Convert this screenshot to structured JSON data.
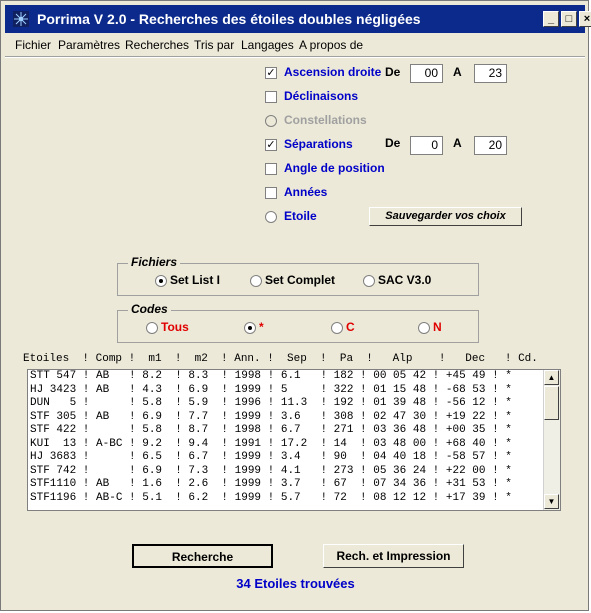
{
  "window": {
    "title": "Porrima V 2.0 - Recherches des étoiles doubles négligées",
    "buttons": {
      "minimize": "_",
      "maximize": "□",
      "close": "×"
    }
  },
  "menu": [
    "Fichier",
    "Paramètres",
    "Recherches",
    "Tris par",
    "Langages",
    "A propos de"
  ],
  "criteria": {
    "ascension": {
      "label": "Ascension droite",
      "checked": true,
      "de_label": "De",
      "from": "00",
      "a_label": "A",
      "to": "23"
    },
    "declinaisons": {
      "label": "Déclinaisons",
      "checked": false
    },
    "constellations": {
      "label": "Constellations",
      "disabled": true
    },
    "separations": {
      "label": "Séparations",
      "checked": true,
      "de_label": "De",
      "from": "0",
      "a_label": "A",
      "to": "20"
    },
    "angle": {
      "label": "Angle de position",
      "checked": false
    },
    "annees": {
      "label": "Années",
      "checked": false
    },
    "etoile": {
      "label": "Etoile",
      "selected": false
    },
    "save_button": "Sauvegarder vos choix"
  },
  "fichiers": {
    "title": "Fichiers",
    "options": [
      {
        "label": "Set List I",
        "selected": true
      },
      {
        "label": "Set Complet",
        "selected": false
      },
      {
        "label": "SAC V3.0",
        "selected": false
      }
    ]
  },
  "codes": {
    "title": "Codes",
    "options": [
      {
        "label": "Tous",
        "selected": false
      },
      {
        "label": "*",
        "selected": true
      },
      {
        "label": "C",
        "selected": false
      },
      {
        "label": "N",
        "selected": false
      }
    ],
    "color": "#e00000"
  },
  "list": {
    "header": "Etoiles  ! Comp !  m1  !  m2  ! Ann. !  Sep  !  Pa  !   Alp    !   Dec   ! Cd.",
    "rows": [
      "STT 547 ! AB   ! 8.2  ! 8.3  ! 1998 ! 6.1   ! 182 ! 00 05 42 ! +45 49 ! *",
      "HJ 3423 ! AB   ! 4.3  ! 6.9  ! 1999 ! 5     ! 322 ! 01 15 48 ! -68 53 ! *",
      "DUN   5 !      ! 5.8  ! 5.9  ! 1996 ! 11.3  ! 192 ! 01 39 48 ! -56 12 ! *",
      "STF 305 ! AB   ! 6.9  ! 7.7  ! 1999 ! 3.6   ! 308 ! 02 47 30 ! +19 22 ! *",
      "STF 422 !      ! 5.8  ! 8.7  ! 1998 ! 6.7   ! 271 ! 03 36 48 ! +00 35 ! *",
      "KUI  13 ! A-BC ! 9.2  ! 9.4  ! 1991 ! 17.2  ! 14  ! 03 48 00 ! +68 40 ! *",
      "HJ 3683 !      ! 6.5  ! 6.7  ! 1999 ! 3.4   ! 90  ! 04 40 18 ! -58 57 ! *",
      "STF 742 !      ! 6.9  ! 7.3  ! 1999 ! 4.1   ! 273 ! 05 36 24 ! +22 00 ! *",
      "STF1110 ! AB   ! 1.6  ! 2.6  ! 1999 ! 3.7   ! 67  ! 07 34 36 ! +31 53 ! *",
      "STF1196 ! AB-C ! 5.1  ! 6.2  ! 1999 ! 5.7   ! 72  ! 08 12 12 ! +17 39 ! *"
    ]
  },
  "buttons": {
    "recherche": "Recherche",
    "rech_impression": "Rech. et Impression"
  },
  "status": "34 Etoiles trouvées"
}
